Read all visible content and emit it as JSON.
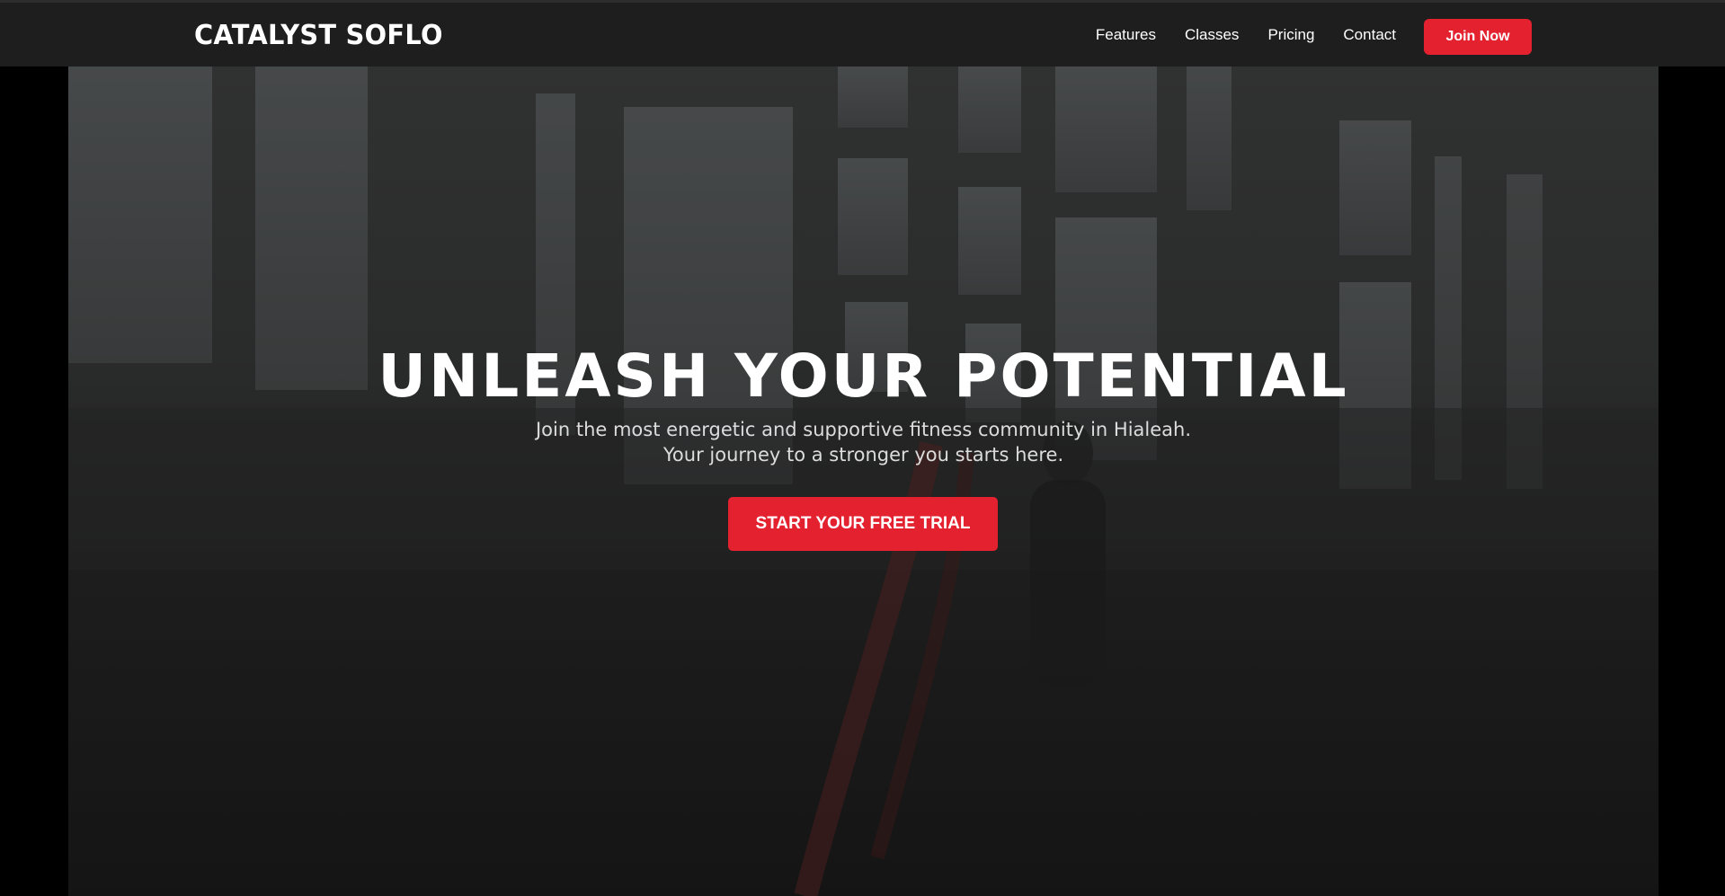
{
  "brand": {
    "name": "CATALYST SOFLO"
  },
  "nav": {
    "items": [
      {
        "label": "Features"
      },
      {
        "label": "Classes"
      },
      {
        "label": "Pricing"
      },
      {
        "label": "Contact"
      }
    ],
    "join_label": "Join Now"
  },
  "hero": {
    "headline": "UNLEASH YOUR POTENTIAL",
    "subtitle_line1": "Join the most energetic and supportive fitness community in Hialeah.",
    "subtitle_line2": "Your journey to a stronger you starts here.",
    "cta_label": "START YOUR FREE TRIAL",
    "background_image": "dark-gym-interior-with-battle-ropes"
  },
  "colors": {
    "accent": "#e3212f",
    "navbar_bg": "#1e1e1e",
    "page_bg": "#000000",
    "text_primary": "#ffffff"
  }
}
